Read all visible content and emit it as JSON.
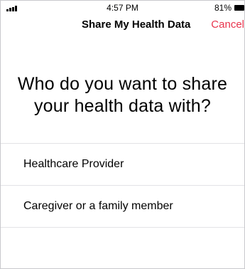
{
  "status_bar": {
    "time": "4:57 PM",
    "battery": "81%"
  },
  "nav": {
    "title": "Share My Health Data",
    "cancel_label": "Cancel"
  },
  "prompt": {
    "question": "Who do you want to share your health data with?"
  },
  "options": [
    {
      "label": "Healthcare Provider"
    },
    {
      "label": "Caregiver or a family member"
    }
  ],
  "colors": {
    "accent": "#e8344d"
  }
}
